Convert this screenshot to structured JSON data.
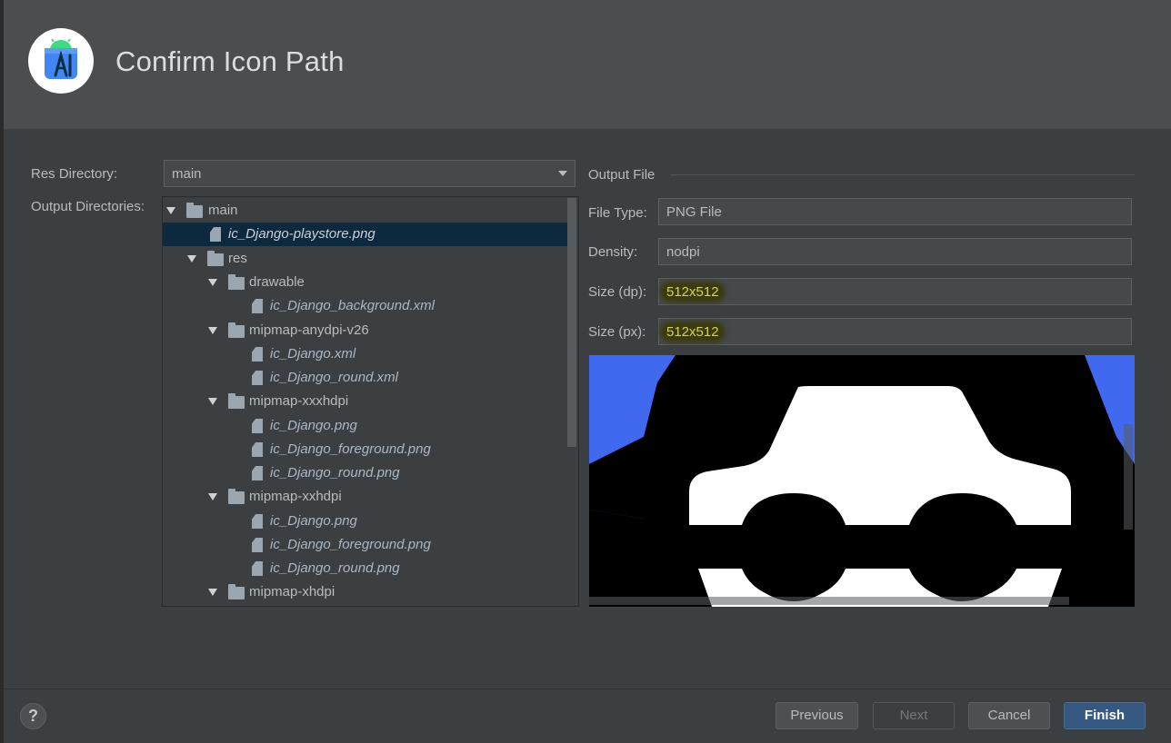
{
  "dialog": {
    "title": "Confirm Icon Path",
    "logo_icon": "android-studio-logo-icon"
  },
  "form": {
    "res_directory_label": "Res Directory:",
    "res_directory_value": "main",
    "output_directories_label": "Output Directories:"
  },
  "tree": [
    {
      "label": "main",
      "kind": "folder",
      "expanded": true
    },
    {
      "label": "ic_Django-playstore.png",
      "kind": "file",
      "selected": true
    },
    {
      "label": "res",
      "kind": "folder",
      "expanded": true
    },
    {
      "label": "drawable",
      "kind": "folder",
      "expanded": true
    },
    {
      "label": "ic_Django_background.xml",
      "kind": "file"
    },
    {
      "label": "mipmap-anydpi-v26",
      "kind": "folder",
      "expanded": true
    },
    {
      "label": "ic_Django.xml",
      "kind": "file"
    },
    {
      "label": "ic_Django_round.xml",
      "kind": "file"
    },
    {
      "label": "mipmap-xxxhdpi",
      "kind": "folder",
      "expanded": true
    },
    {
      "label": "ic_Django.png",
      "kind": "file"
    },
    {
      "label": "ic_Django_foreground.png",
      "kind": "file"
    },
    {
      "label": "ic_Django_round.png",
      "kind": "file"
    },
    {
      "label": "mipmap-xxhdpi",
      "kind": "folder",
      "expanded": true
    },
    {
      "label": "ic_Django.png",
      "kind": "file"
    },
    {
      "label": "ic_Django_foreground.png",
      "kind": "file"
    },
    {
      "label": "ic_Django_round.png",
      "kind": "file"
    },
    {
      "label": "mipmap-xhdpi",
      "kind": "folder",
      "expanded": true
    }
  ],
  "output_file": {
    "section_label": "Output File",
    "file_type_label": "File Type:",
    "file_type_value": "PNG File",
    "density_label": "Density:",
    "density_value": "nodpi",
    "size_dp_label": "Size (dp):",
    "size_dp_value": "512x512",
    "size_px_label": "Size (px):",
    "size_px_value": "512x512"
  },
  "colors": {
    "preview_background": "#4169f0",
    "selection": "#0d293e",
    "primary_button": "#365880",
    "highlight": "#3b3b10"
  },
  "footer": {
    "help_label": "?",
    "previous_label": "Previous",
    "next_label": "Next",
    "cancel_label": "Cancel",
    "finish_label": "Finish"
  }
}
